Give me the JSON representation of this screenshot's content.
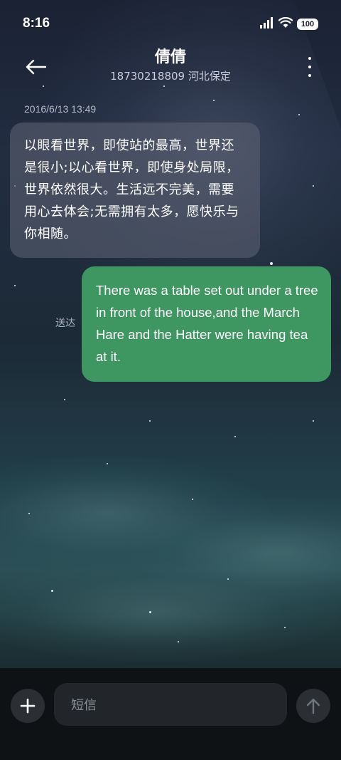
{
  "status_bar": {
    "time": "8:16",
    "battery": "100",
    "icons": [
      "signal-icon",
      "wifi-icon",
      "battery-icon"
    ]
  },
  "header": {
    "contact_name": "倩倩",
    "contact_subtitle": "18730218809 河北保定",
    "back_icon": "back-arrow-icon",
    "more_icon": "more-vertical-icon"
  },
  "conversation": {
    "timestamp": "2016/6/13 13:49",
    "incoming_message": "以眼看世界，即使站的最高，世界还是很小;以心看世界，即使身处局限，世界依然很大。生活远不完美，需要用心去体会;无需拥有太多，愿快乐与你相随。",
    "outgoing_message": "There was a table set out under a tree in front of the house,and the March Hare and the Hatter were having tea at it.",
    "outgoing_status": "送达"
  },
  "composer": {
    "placeholder": "短信",
    "add_icon": "plus-icon",
    "send_icon": "send-arrow-up-icon"
  },
  "colors": {
    "outgoing_bubble": "#3e9661",
    "incoming_bubble": "#586070",
    "composer_background": "#0f1214"
  }
}
